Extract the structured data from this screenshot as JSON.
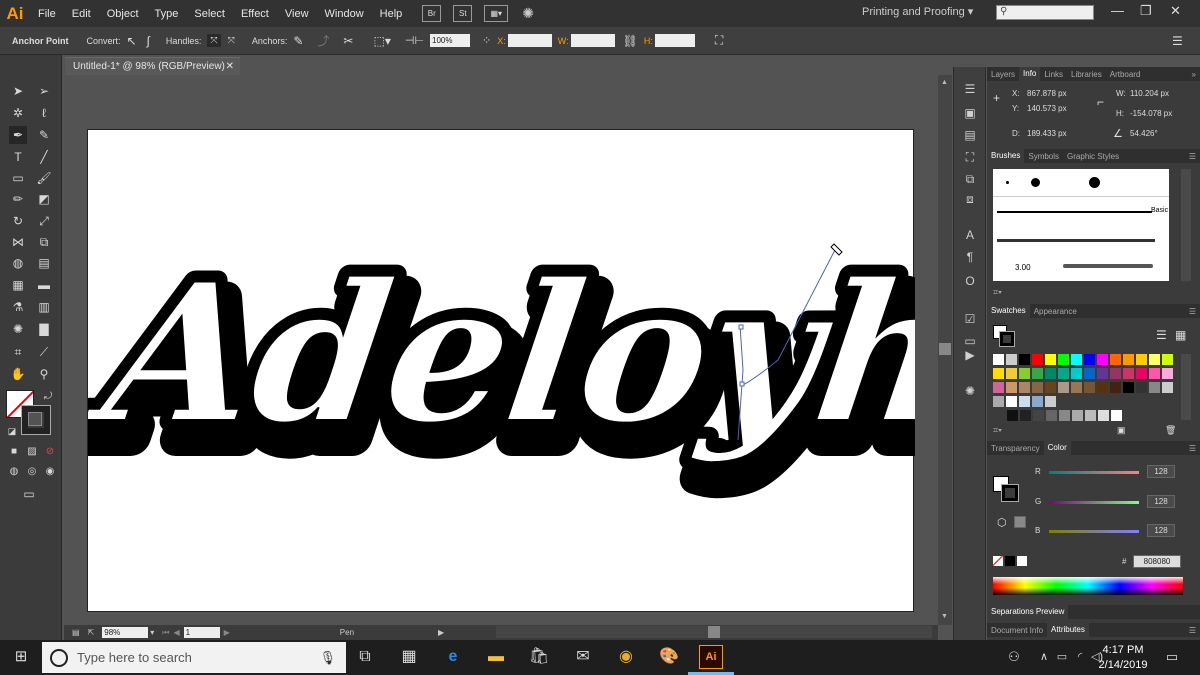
{
  "app": {
    "logo": "Ai",
    "menus": [
      "File",
      "Edit",
      "Object",
      "Type",
      "Select",
      "Effect",
      "View",
      "Window",
      "Help"
    ],
    "workspace": "Printing and Proofing",
    "bridge_label": "Br",
    "stock_label": "St"
  },
  "control_bar": {
    "tool_label": "Anchor Point",
    "convert_label": "Convert:",
    "handles_label": "Handles:",
    "anchors_label": "Anchors:",
    "zoom_value": "100%",
    "x_label": "X:",
    "w_label": "W:",
    "h_label": "H:"
  },
  "document": {
    "tab_title": "Untitled-1* @ 98% (RGB/Preview)",
    "artwork_text": "Adeloyh"
  },
  "status_bar": {
    "zoom": "98%",
    "artboard_number": "1",
    "current_tool": "Pen"
  },
  "info_panel": {
    "tabs": [
      "Layers",
      "Info",
      "Links",
      "Libraries",
      "Artboard"
    ],
    "active_tab": "Info",
    "x": "867.878 px",
    "y": "140.573 px",
    "w": "110.204 px",
    "h": "-154.078 px",
    "d": "189.433 px",
    "angle": "54.426°",
    "x_label": "X:",
    "y_label": "Y:",
    "w_label": "W:",
    "h_label": "H:",
    "d_label": "D:"
  },
  "brushes_panel": {
    "tabs": [
      "Brushes",
      "Symbols",
      "Graphic Styles"
    ],
    "active_tab": "Brushes",
    "basic_label": "Basic",
    "stroke_weight": "3.00"
  },
  "swatches_panel": {
    "tabs": [
      "Swatches",
      "Appearance"
    ],
    "active_tab": "Swatches"
  },
  "color_panel": {
    "tabs": [
      "Transparency",
      "Color"
    ],
    "active_tab": "Color",
    "r_label": "R",
    "g_label": "G",
    "b_label": "B",
    "r": "128",
    "g": "128",
    "b": "128",
    "hex_label": "#",
    "hex": "808080"
  },
  "bottom_tabs": {
    "separations": "Separations Preview",
    "document_info": "Document Info",
    "attributes": "Attributes"
  },
  "taskbar": {
    "search_placeholder": "Type here to search",
    "time": "4:17 PM",
    "date": "2/14/2019"
  },
  "colors": {
    "accent": "#ff9a00",
    "panel": "#3b3b3b",
    "canvas": "#535353",
    "selection_path": "#5060c0"
  }
}
